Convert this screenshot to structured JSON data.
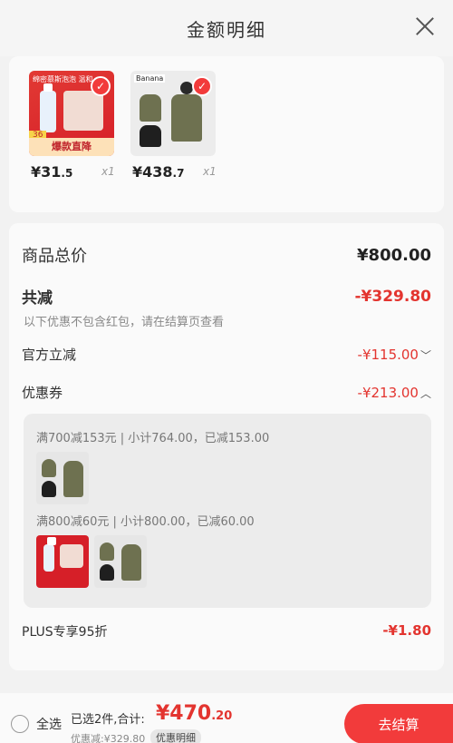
{
  "header": {
    "title": "金额明细"
  },
  "products": [
    {
      "price_main": "¥31",
      "price_dec": ".5",
      "qty": "x1",
      "top_text": "绵密慕斯泡泡  温和",
      "band": "爆款直降",
      "tag": "36"
    },
    {
      "price_main": "¥438",
      "price_dec": ".7",
      "qty": "x1",
      "brand": "Banana"
    }
  ],
  "summary": {
    "goods_total_label": "商品总价",
    "goods_total_value": "¥800.00",
    "discount_label": "共减",
    "discount_value": "-¥329.80",
    "discount_note": "以下优惠不包含红包，请在结算页查看",
    "official_label": "官方立减",
    "official_value": "-¥115.00",
    "coupon_label": "优惠券",
    "coupon_value": "-¥213.00",
    "coupon_line1": "满700减153元 | 小计764.00，已减153.00",
    "coupon_line2": "满800减60元 | 小计800.00，已减60.00",
    "plus_label": "PLUS专享95折",
    "plus_value": "-¥1.80"
  },
  "bottom": {
    "select_all": "全选",
    "summary_text": "已选2件,合计:",
    "total_main": "¥470",
    "total_dec": ".20",
    "saved": "优惠减:¥329.80",
    "detail_button": "优惠明细",
    "checkout": "去结算"
  },
  "colors": {
    "accent_red": "#e3342f",
    "button_red": "#f23b3b"
  }
}
